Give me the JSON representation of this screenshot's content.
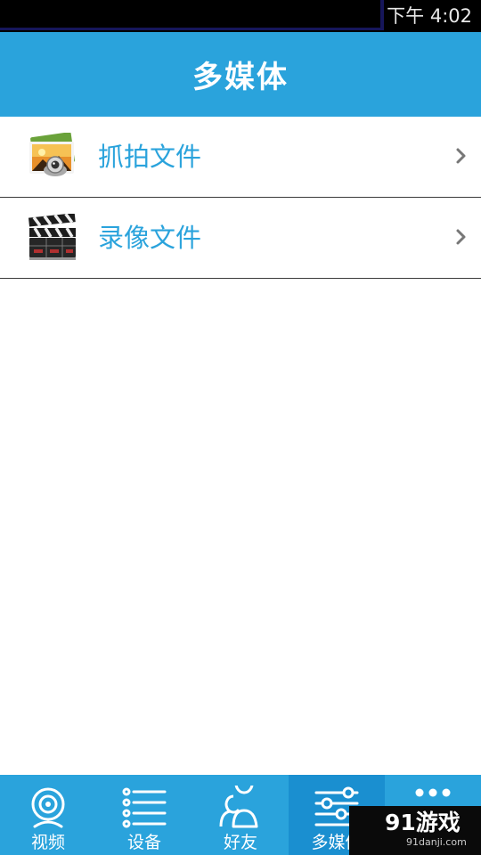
{
  "status_bar": {
    "time": "下午 4:02"
  },
  "header": {
    "title": "多媒体"
  },
  "list": {
    "items": [
      {
        "label": "抓拍文件",
        "icon": "photos-icon"
      },
      {
        "label": "录像文件",
        "icon": "clapperboard-icon"
      }
    ]
  },
  "bottom_nav": {
    "items": [
      {
        "label": "视频",
        "icon": "webcam-icon"
      },
      {
        "label": "设备",
        "icon": "device-list-icon"
      },
      {
        "label": "好友",
        "icon": "friends-icon"
      },
      {
        "label": "多媒体",
        "icon": "media-sliders-icon",
        "active": true
      },
      {
        "label": "",
        "icon": "more-icon"
      }
    ]
  },
  "watermark": {
    "main": "91游戏",
    "sub": "91danji.com"
  },
  "colors": {
    "brand": "#2aa3dc",
    "active_tab": "#1a8fd0",
    "status_bar": "#000000"
  }
}
